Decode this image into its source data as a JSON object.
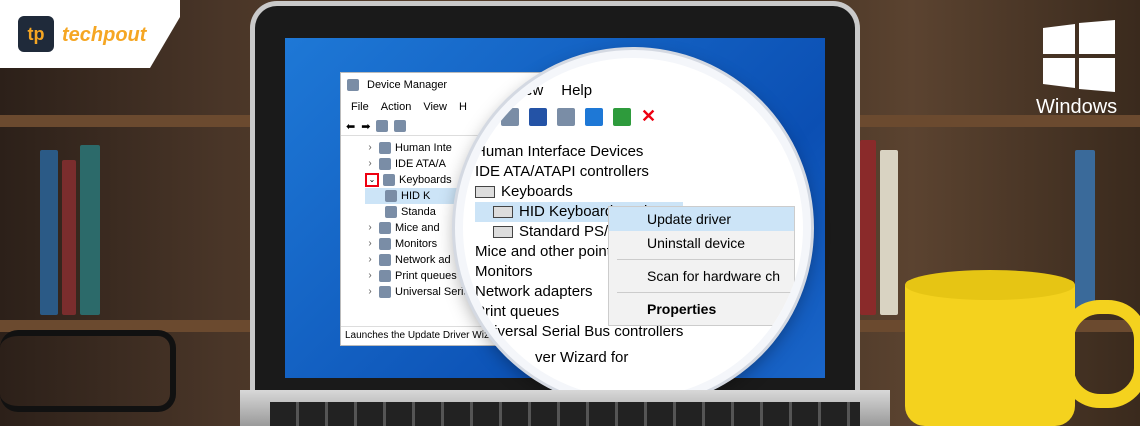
{
  "logo": {
    "mark": "tp",
    "text": "techpout"
  },
  "brand": {
    "label": "Windows"
  },
  "device_manager": {
    "title": "Device Manager",
    "menu": [
      "File",
      "Action",
      "View",
      "H"
    ],
    "tree": [
      {
        "label": "Human Inte",
        "expanded": false
      },
      {
        "label": "IDE ATA/A",
        "expanded": false
      },
      {
        "label": "Keyboards",
        "expanded": true
      },
      {
        "label": "HID K",
        "child": true
      },
      {
        "label": "Standa",
        "child": true
      },
      {
        "label": "Mice and",
        "expanded": false
      },
      {
        "label": "Monitors",
        "expanded": false
      },
      {
        "label": "Network ad",
        "expanded": false
      },
      {
        "label": "Print queues",
        "expanded": false
      },
      {
        "label": "Universal Serial",
        "expanded": false
      }
    ],
    "status": "Launches the Update Driver Wizard"
  },
  "lens": {
    "menu": [
      "View",
      "Help"
    ],
    "list": [
      "Human Interface Devices",
      "IDE ATA/ATAPI controllers",
      "Keyboards",
      "HID Keyboard Devi",
      "Standard PS/2 Keyb",
      "Mice and other pointin",
      "Monitors",
      "Network adapters",
      "Print queues",
      "Universal Serial Bus controllers",
      "ver Wizard for"
    ],
    "context_menu": {
      "update": "Update driver",
      "uninstall": "Uninstall device",
      "scan": "Scan for hardware ch",
      "properties": "Properties"
    }
  },
  "colors": {
    "accent": "#f5a623",
    "desktop": "#0b4fb3",
    "mug": "#f4d21e"
  }
}
